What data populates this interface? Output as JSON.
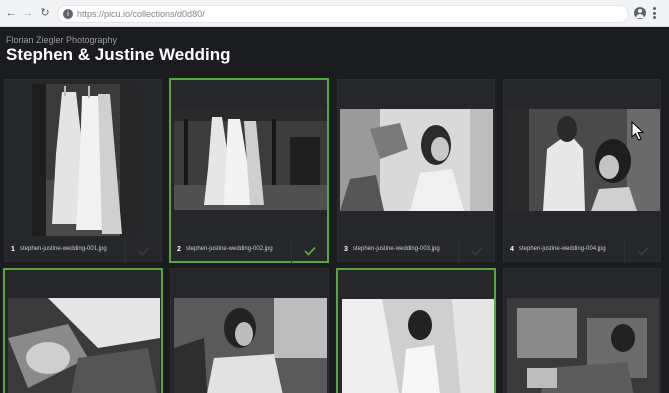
{
  "browser": {
    "url": "https://picu.io/collections/d0d80/",
    "nav_icons": {
      "back": "←",
      "forward": "→",
      "reload": "↻"
    },
    "info_icon": "i"
  },
  "header": {
    "photographer": "Florian Ziegler Photography",
    "title": "Stephen & Justine Wedding"
  },
  "photos": [
    {
      "number": "1",
      "filename": "stephen-justine-wedding-001.jpg",
      "selected": false
    },
    {
      "number": "2",
      "filename": "stephen-justine-wedding-002.jpg",
      "selected": true
    },
    {
      "number": "3",
      "filename": "stephen-justine-wedding-003.jpg",
      "selected": false
    },
    {
      "number": "4",
      "filename": "stephen-justine-wedding-004.jpg",
      "selected": false
    },
    {
      "selected": true
    },
    {
      "selected": false
    },
    {
      "selected": true
    },
    {
      "selected": false
    }
  ],
  "colors": {
    "background": "#1b1c1f",
    "card": "#26272b",
    "selected_accent": "#57a83a",
    "check_inactive": "#3a3b40"
  }
}
